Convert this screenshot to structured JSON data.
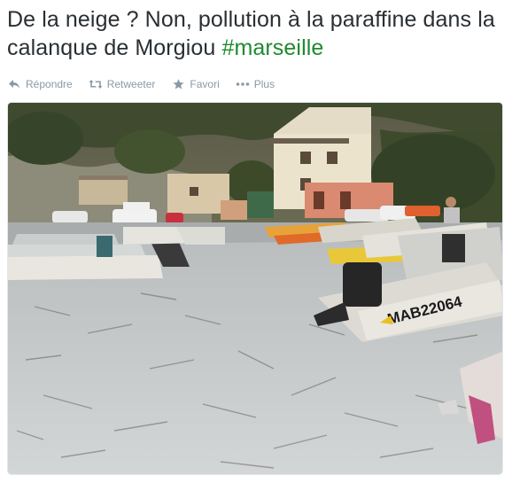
{
  "tweet": {
    "text_main": "De la neige ? Non, pollution à la paraffine dans la calanque de Morgiou ",
    "hashtag": "#marseille",
    "accent_color": "#1e8a2e"
  },
  "actions": [
    {
      "label": "Répondre",
      "icon": "reply-icon"
    },
    {
      "label": "Retweeter",
      "icon": "retweet-icon"
    },
    {
      "label": "Favori",
      "icon": "star-icon"
    },
    {
      "label": "Plus",
      "icon": "more-icon"
    }
  ],
  "photo": {
    "boat_registration": "MAB22064"
  }
}
